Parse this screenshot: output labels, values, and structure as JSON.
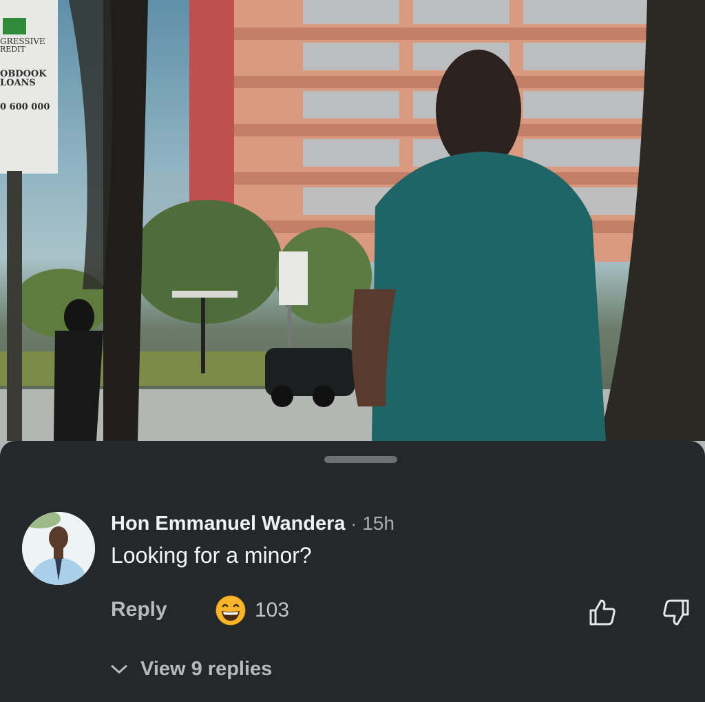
{
  "video": {
    "billboard_lines": [
      "GRESSIVE",
      "REDIT",
      "OBDOOK",
      "LOANS",
      "0 600 000"
    ]
  },
  "comment": {
    "author": "Hon Emmanuel Wandera",
    "separator": "·",
    "time": "15h",
    "text": "Looking for a minor?",
    "reply_label": "Reply",
    "reaction_icon": "grinning-emoji-icon",
    "reaction_count": "103",
    "view_replies_label": "View 9 replies"
  },
  "colors": {
    "sheet_bg": "#25282a",
    "text_primary": "#f5f5f5",
    "text_secondary": "#a9acae"
  }
}
